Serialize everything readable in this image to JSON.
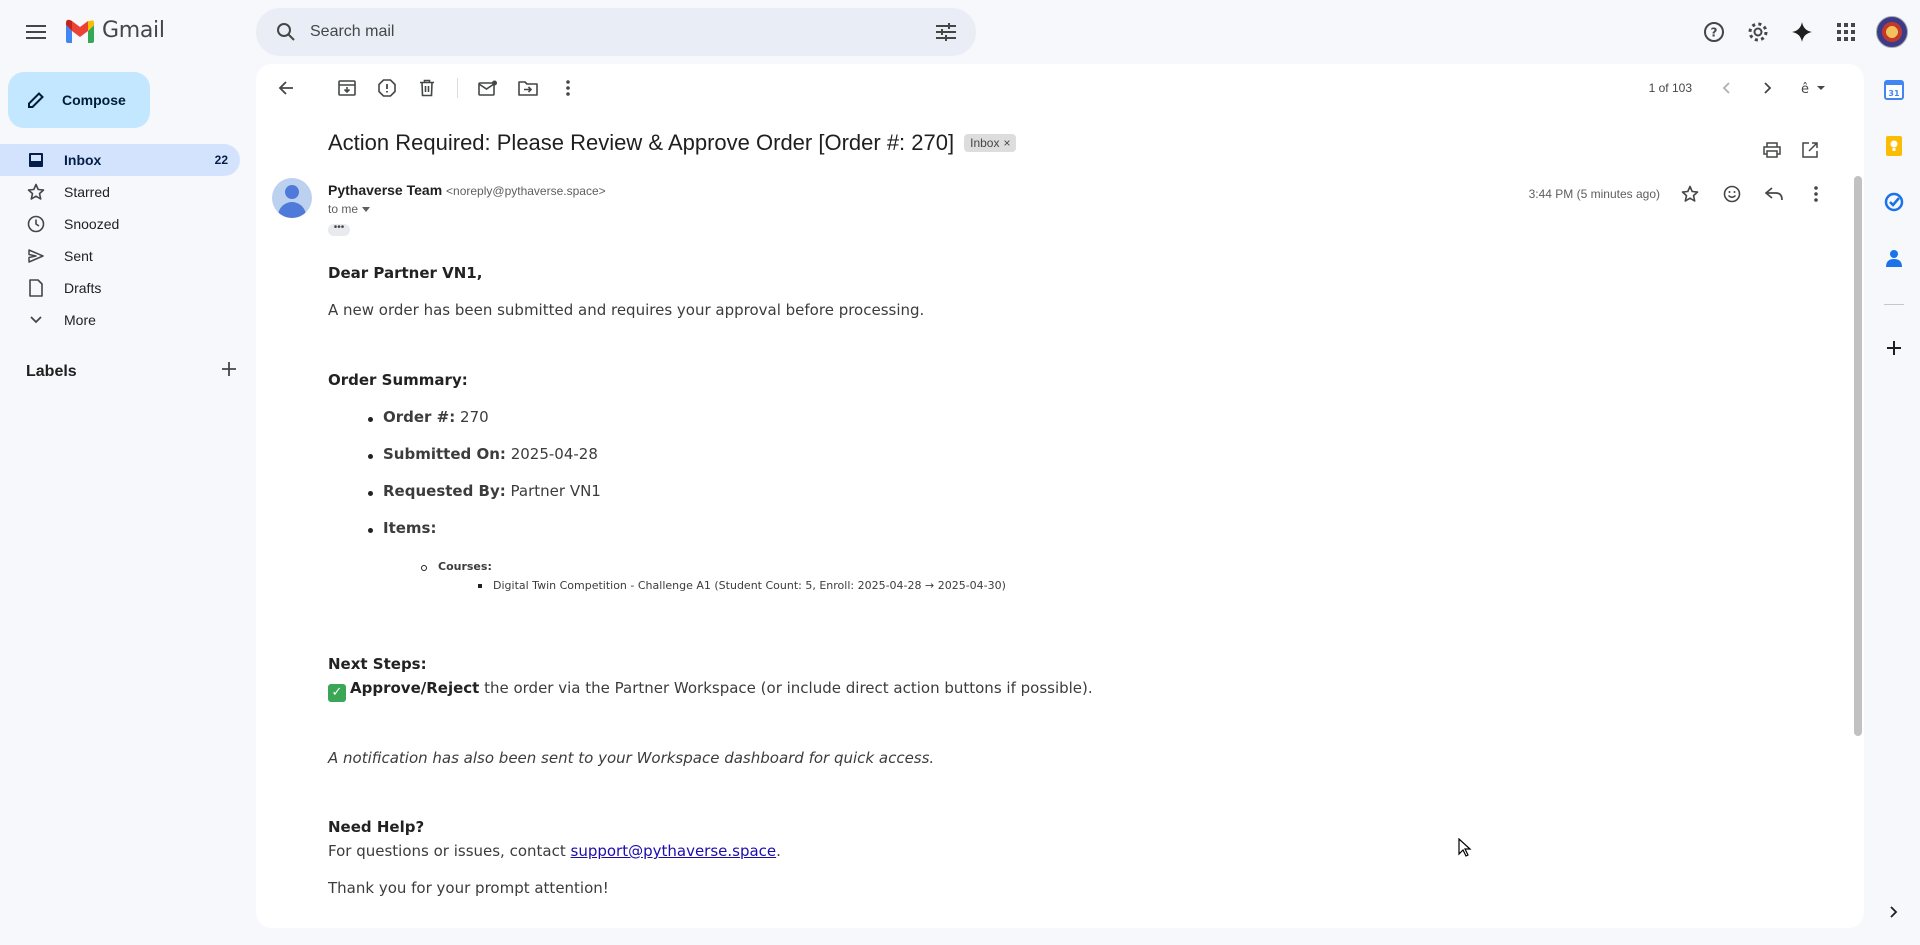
{
  "app": {
    "name": "Gmail",
    "search_placeholder": "Search mail",
    "compose_label": "Compose",
    "colors": {
      "accent": "#c2e7ff",
      "active_nav": "#d3e3fd",
      "background": "#f6f8fc"
    }
  },
  "sidebar": {
    "items": [
      {
        "label": "Inbox",
        "count": "22",
        "icon": "inbox-icon",
        "active": true
      },
      {
        "label": "Starred",
        "count": "",
        "icon": "star-icon"
      },
      {
        "label": "Snoozed",
        "count": "",
        "icon": "clock-icon"
      },
      {
        "label": "Sent",
        "count": "",
        "icon": "send-icon"
      },
      {
        "label": "Drafts",
        "count": "",
        "icon": "draft-icon"
      },
      {
        "label": "More",
        "count": "",
        "icon": "chevron-down-icon"
      }
    ],
    "labels_title": "Labels"
  },
  "toolbar": {
    "pagination": "1 of 103"
  },
  "email": {
    "subject": "Action Required: Please Review & Approve Order [Order #: 270]",
    "label_chip": "Inbox",
    "chip_close": "×",
    "sender_name": "Pythaverse Team",
    "sender_email": "<noreply@pythaverse.space>",
    "to": "to me",
    "time": "3:44 PM (5 minutes ago)",
    "body": {
      "greeting": "Dear Partner VN1,",
      "intro": "A new order has been submitted and requires your approval before processing.",
      "summary_heading": "Order Summary:",
      "order_label": "Order #:",
      "order_value": "270",
      "submitted_label": "Submitted On:",
      "submitted_value": "2025-04-28",
      "requested_label": "Requested By:",
      "requested_value": "Partner VN1",
      "items_label": "Items:",
      "courses_label": "Courses:",
      "course_line": "Digital Twin Competition - Challenge A1 (Student Count: 5, Enroll: 2025-04-28 → 2025-04-30)",
      "next_steps_heading": "Next Steps:",
      "check_mark": "✓",
      "approve_label": "Approve/Reject",
      "approve_text": " the order via the Partner Workspace (or include direct action buttons if possible).",
      "notification": "A notification has also been sent to your Workspace dashboard for quick access.",
      "help_heading": "Need Help?",
      "help_text": "For questions or issues, contact ",
      "help_email": "support@pythaverse.space",
      "help_period": ".",
      "thanks": "Thank you for your prompt attention!"
    }
  }
}
